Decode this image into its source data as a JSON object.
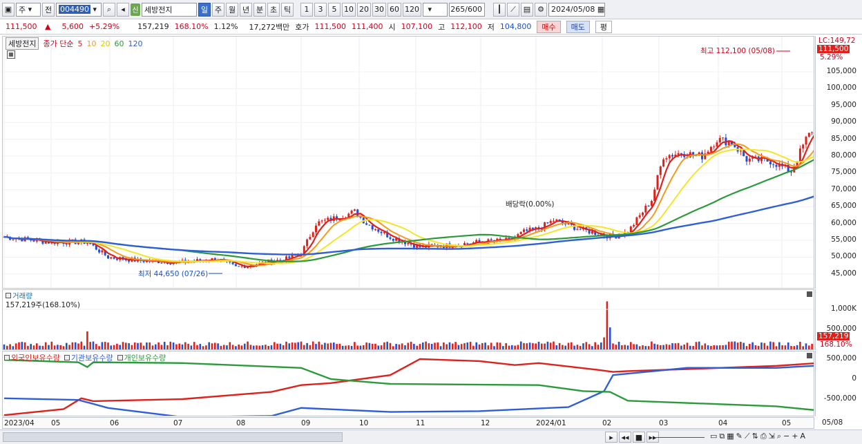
{
  "toolbar": {
    "market": "주",
    "mode": "전",
    "code": "004490",
    "name_badge": "신",
    "name": "세방전지",
    "periods": [
      "일",
      "주",
      "월",
      "년",
      "분",
      "초",
      "틱"
    ],
    "active_period": "일",
    "nums": [
      "1",
      "3",
      "5",
      "10",
      "20",
      "30",
      "60",
      "120"
    ],
    "count": "265",
    "count_total": "/600",
    "date": "2024/05/08"
  },
  "quote": {
    "price": "111,500",
    "arrow": "▲",
    "change": "5,600",
    "pct": "+5.29%",
    "volume": "157,219",
    "vol_ratio": "168.10%",
    "turnover": "1.12%",
    "amount": "17,272백만",
    "bid_label": "호가",
    "ask": "111,500",
    "bid": "111,400",
    "open_label": "시",
    "open": "107,100",
    "high_label": "고",
    "high": "112,100",
    "low_label": "저",
    "low": "104,800",
    "buy": "매수",
    "sell": "매도",
    "eval": "평"
  },
  "price_pane": {
    "name_tag": "세방전지",
    "legend_title": "종가 단순",
    "ma": [
      "5",
      "10",
      "20",
      "60",
      "120"
    ],
    "max_label": "최고 112,100 (05/08)",
    "min_label": "최저 44,650 (07/26)",
    "div_label": "배당락(0.00%)",
    "lc_label": "LC:149,72",
    "last_tag": "111,500",
    "last_pct": "5.29%",
    "yticks": [
      "105,000",
      "100,000",
      "95,000",
      "90,000",
      "85,000",
      "80,000",
      "75,000",
      "70,000",
      "65,000",
      "60,000",
      "55,000",
      "50,000",
      "45,000"
    ]
  },
  "vol_pane": {
    "title": "거래량",
    "value": "157,219주(168.10%)",
    "yticks": [
      "1,000K",
      "500,000"
    ],
    "last_tag": "157,219",
    "last_pct": "168.10%"
  },
  "hold_pane": {
    "s1": "외국인보유수량",
    "s2": "기관보유수량",
    "s3": "개인보유수량",
    "yticks": [
      "500,000",
      "0",
      "-500,000"
    ]
  },
  "xaxis": [
    "2023/04",
    "05",
    "06",
    "07",
    "08",
    "09",
    "10",
    "11",
    "12",
    "2024/01",
    "02",
    "03",
    "04",
    "05",
    "05/08"
  ],
  "colors": {
    "up": "#e0201b",
    "down": "#1f4fd6",
    "ma5": "#e0201b",
    "ma10": "#f39a1e",
    "ma20": "#f2e52a",
    "ma60": "#2a9a3a",
    "ma120": "#2f5fd8"
  }
}
